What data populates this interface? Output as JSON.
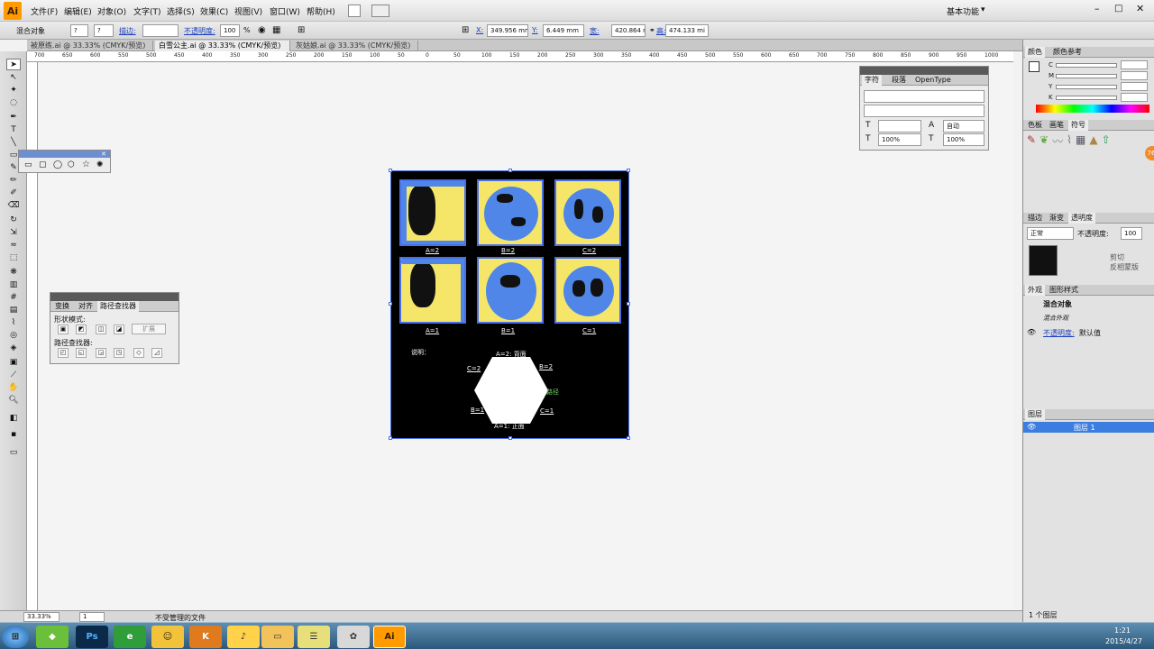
{
  "app": {
    "logo": "Ai",
    "workspace": "基本功能"
  },
  "menu": [
    "文件(F)",
    "编辑(E)",
    "对象(O)",
    "文字(T)",
    "选择(S)",
    "效果(C)",
    "视图(V)",
    "窗口(W)",
    "帮助(H)"
  ],
  "control_bar": {
    "object_type": "混合对象",
    "stroke_label": "描边:",
    "opacity_label": "不透明度:",
    "opacity_value": "100",
    "percent": "%",
    "x_label": "X:",
    "x_value": "349.956 mm",
    "y_label": "Y:",
    "y_value": "6.449 mm",
    "w_label": "宽:",
    "w_value": "420.864 m",
    "h_label": "高:",
    "h_value": "474.133 mi"
  },
  "doc_tabs": [
    "被原练.ai @ 33.33% (CMYK/预览)",
    "白雪公主.ai @ 33.33% (CMYK/预览)",
    "灰姑娘.ai @ 33.33% (CMYK/预览)"
  ],
  "ruler_ticks": [
    "700",
    "650",
    "600",
    "550",
    "500",
    "450",
    "400",
    "350",
    "300",
    "250",
    "200",
    "150",
    "100",
    "50",
    "0",
    "50",
    "100",
    "150",
    "200",
    "250",
    "300",
    "350",
    "400",
    "450",
    "500",
    "550",
    "600",
    "650",
    "700",
    "750",
    "800",
    "850",
    "900",
    "950",
    "1000"
  ],
  "char_panel": {
    "tabs": [
      "字符",
      "段落",
      "OpenType"
    ],
    "leading": "自动",
    "hscale": "100%",
    "vscale": "100%"
  },
  "pathfinder_panel": {
    "tabs": [
      "变换",
      "对齐",
      "路径查找器"
    ],
    "shape_modes": "形状模式:",
    "expand": "扩展",
    "pathfinders": "路径查找器:"
  },
  "artboard": {
    "labels_row1": [
      "A=2",
      "B=2",
      "C=2"
    ],
    "labels_row2": [
      "A=1",
      "B=1",
      "C=1"
    ],
    "note": "说明：",
    "hex_labels": {
      "top": "A=2: 背面",
      "tl": "C=2",
      "tr": "B=2",
      "right": "路径",
      "bl": "B=1",
      "br": "C=1",
      "bottom": "A=1: 正面"
    }
  },
  "dock": {
    "color_tabs": [
      "颜色",
      "颜色参考"
    ],
    "cmyk": [
      "C",
      "M",
      "Y",
      "K"
    ],
    "swatch_tabs": [
      "色板",
      "画笔",
      "符号"
    ],
    "stroke_tabs": [
      "描边",
      "渐变",
      "透明度"
    ],
    "blend_mode": "正常",
    "opacity_label": "不透明度:",
    "opacity_value": "100",
    "clip": "剪切",
    "invert_mask": "反相蒙版",
    "appearance_tabs": [
      "外观",
      "图形样式"
    ],
    "appearance_title": "混合对象",
    "appearance_sub": "混合外观",
    "appearance_opacity": "不透明度:",
    "appearance_default": "默认值",
    "layers_tab": "图层",
    "layer_name": "图层 1",
    "layer_count": "1 个图层",
    "badge": "76"
  },
  "status": {
    "zoom": "33.33%",
    "page": "1",
    "message": "不受管理的文件"
  },
  "taskbar": {
    "time": "1:21",
    "date": "2015/4/27",
    "apps": [
      "Ps",
      "Ai"
    ]
  }
}
